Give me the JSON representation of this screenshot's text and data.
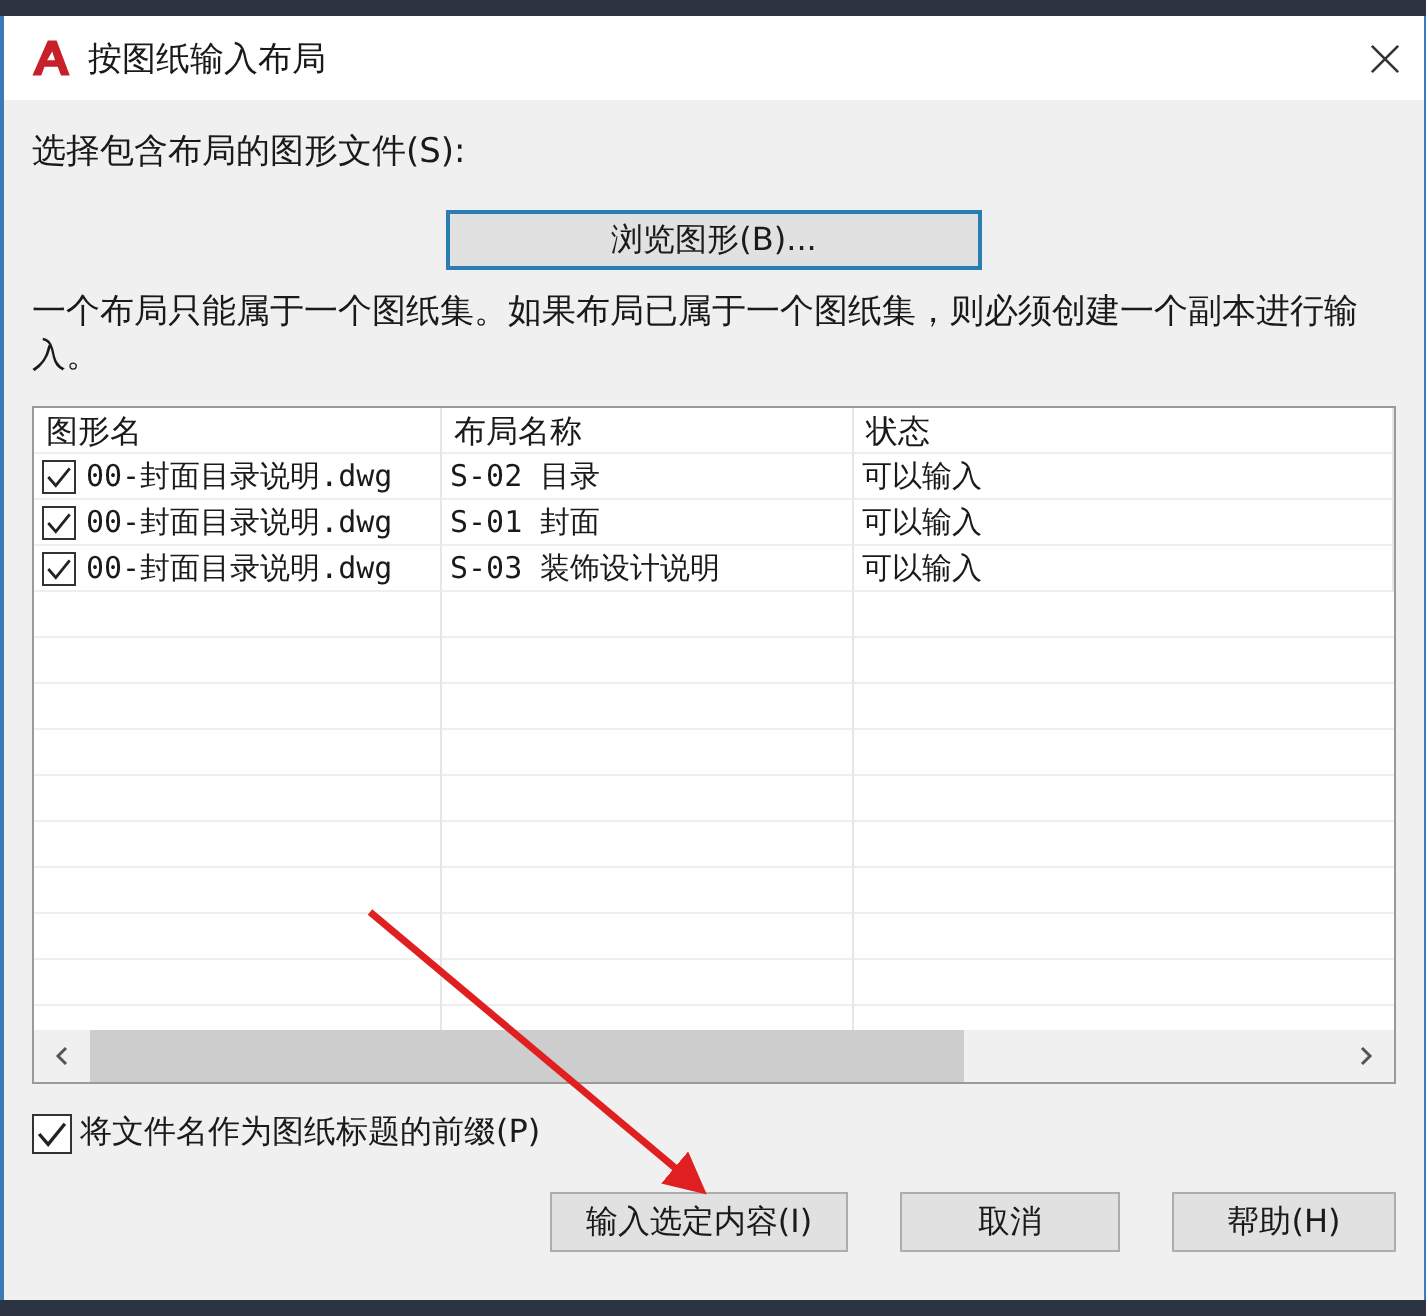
{
  "window": {
    "title": "按图纸输入布局"
  },
  "file_prompt": "选择包含布局的图形文件(S):",
  "browse_button": "浏览图形(B)...",
  "note": "一个布局只能属于一个图纸集。如果布局已属于一个图纸集，则必须创建一个副本进行输入。",
  "table": {
    "columns": [
      "图形名",
      "布局名称",
      "状态"
    ],
    "rows": [
      {
        "checked": true,
        "cells": [
          "00-封面目录说明.dwg",
          "S-02 目录",
          "可以输入"
        ]
      },
      {
        "checked": true,
        "cells": [
          "00-封面目录说明.dwg",
          "S-01 封面",
          "可以输入"
        ]
      },
      {
        "checked": true,
        "cells": [
          "00-封面目录说明.dwg",
          "S-03 装饰设计说明",
          "可以输入"
        ]
      }
    ]
  },
  "prefix_option": {
    "label": "将文件名作为图纸标题的前缀(P)",
    "checked": true
  },
  "buttons": [
    "输入选定内容(I)",
    "取消",
    "帮助(H)"
  ]
}
